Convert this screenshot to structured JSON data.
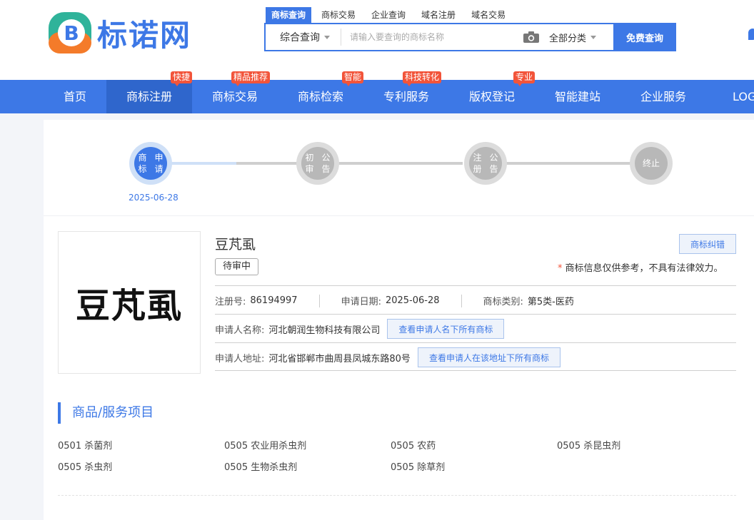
{
  "header": {
    "logo_text": "标诺网",
    "logo_letter": "B"
  },
  "search": {
    "tabs": [
      "商标查询",
      "商标交易",
      "企业查询",
      "域名注册",
      "域名交易"
    ],
    "active_tab": 0,
    "type_label": "综合查询",
    "placeholder": "请输入要查询的商标名称",
    "category_label": "全部分类",
    "submit_label": "免费查询"
  },
  "nav": {
    "items": [
      {
        "label": "首页",
        "badge": ""
      },
      {
        "label": "商标注册",
        "badge": "快捷"
      },
      {
        "label": "商标交易",
        "badge": "精品推荐"
      },
      {
        "label": "商标检索",
        "badge": "智能"
      },
      {
        "label": "专利服务",
        "badge": "科技转化"
      },
      {
        "label": "版权登记",
        "badge": "专业"
      },
      {
        "label": "智能建站",
        "badge": ""
      },
      {
        "label": "企业服务",
        "badge": ""
      },
      {
        "label": "LOGO",
        "badge": ""
      }
    ],
    "active_index": 1
  },
  "progress": {
    "steps": [
      {
        "line1": "商标",
        "line2": "申请",
        "done": true
      },
      {
        "line1": "初审",
        "line2": "公告",
        "done": false
      },
      {
        "line1": "注册",
        "line2": "公告",
        "done": false
      },
      {
        "line1": "终止",
        "line2": "",
        "done": false
      }
    ],
    "date": "2025-06-28"
  },
  "trademark": {
    "image_text": "豆芃虱",
    "name": "豆芃虱",
    "status": "待审中",
    "correct_button": "商标纠错",
    "disclaimer": "商标信息仅供参考，不具有法律效力。",
    "reg_no_label": "注册号:",
    "reg_no": "86194997",
    "apply_date_label": "申请日期:",
    "apply_date": "2025-06-28",
    "class_label": "商标类别:",
    "class_value": "第5类-医药",
    "applicant_label": "申请人名称:",
    "applicant": "河北朝润生物科技有限公司",
    "applicant_button": "查看申请人名下所有商标",
    "address_label": "申请人地址:",
    "address": "河北省邯郸市曲周县凤城东路80号",
    "address_button": "查看申请人在该地址下所有商标"
  },
  "goods": {
    "title": "商品/服务项目",
    "items": [
      "0501 杀菌剂",
      "0505 农业用杀虫剂",
      "0505 农药",
      "0505 杀昆虫剂",
      "0505 杀虫剂",
      "0505 生物杀虫剂",
      "0505 除草剂"
    ]
  }
}
